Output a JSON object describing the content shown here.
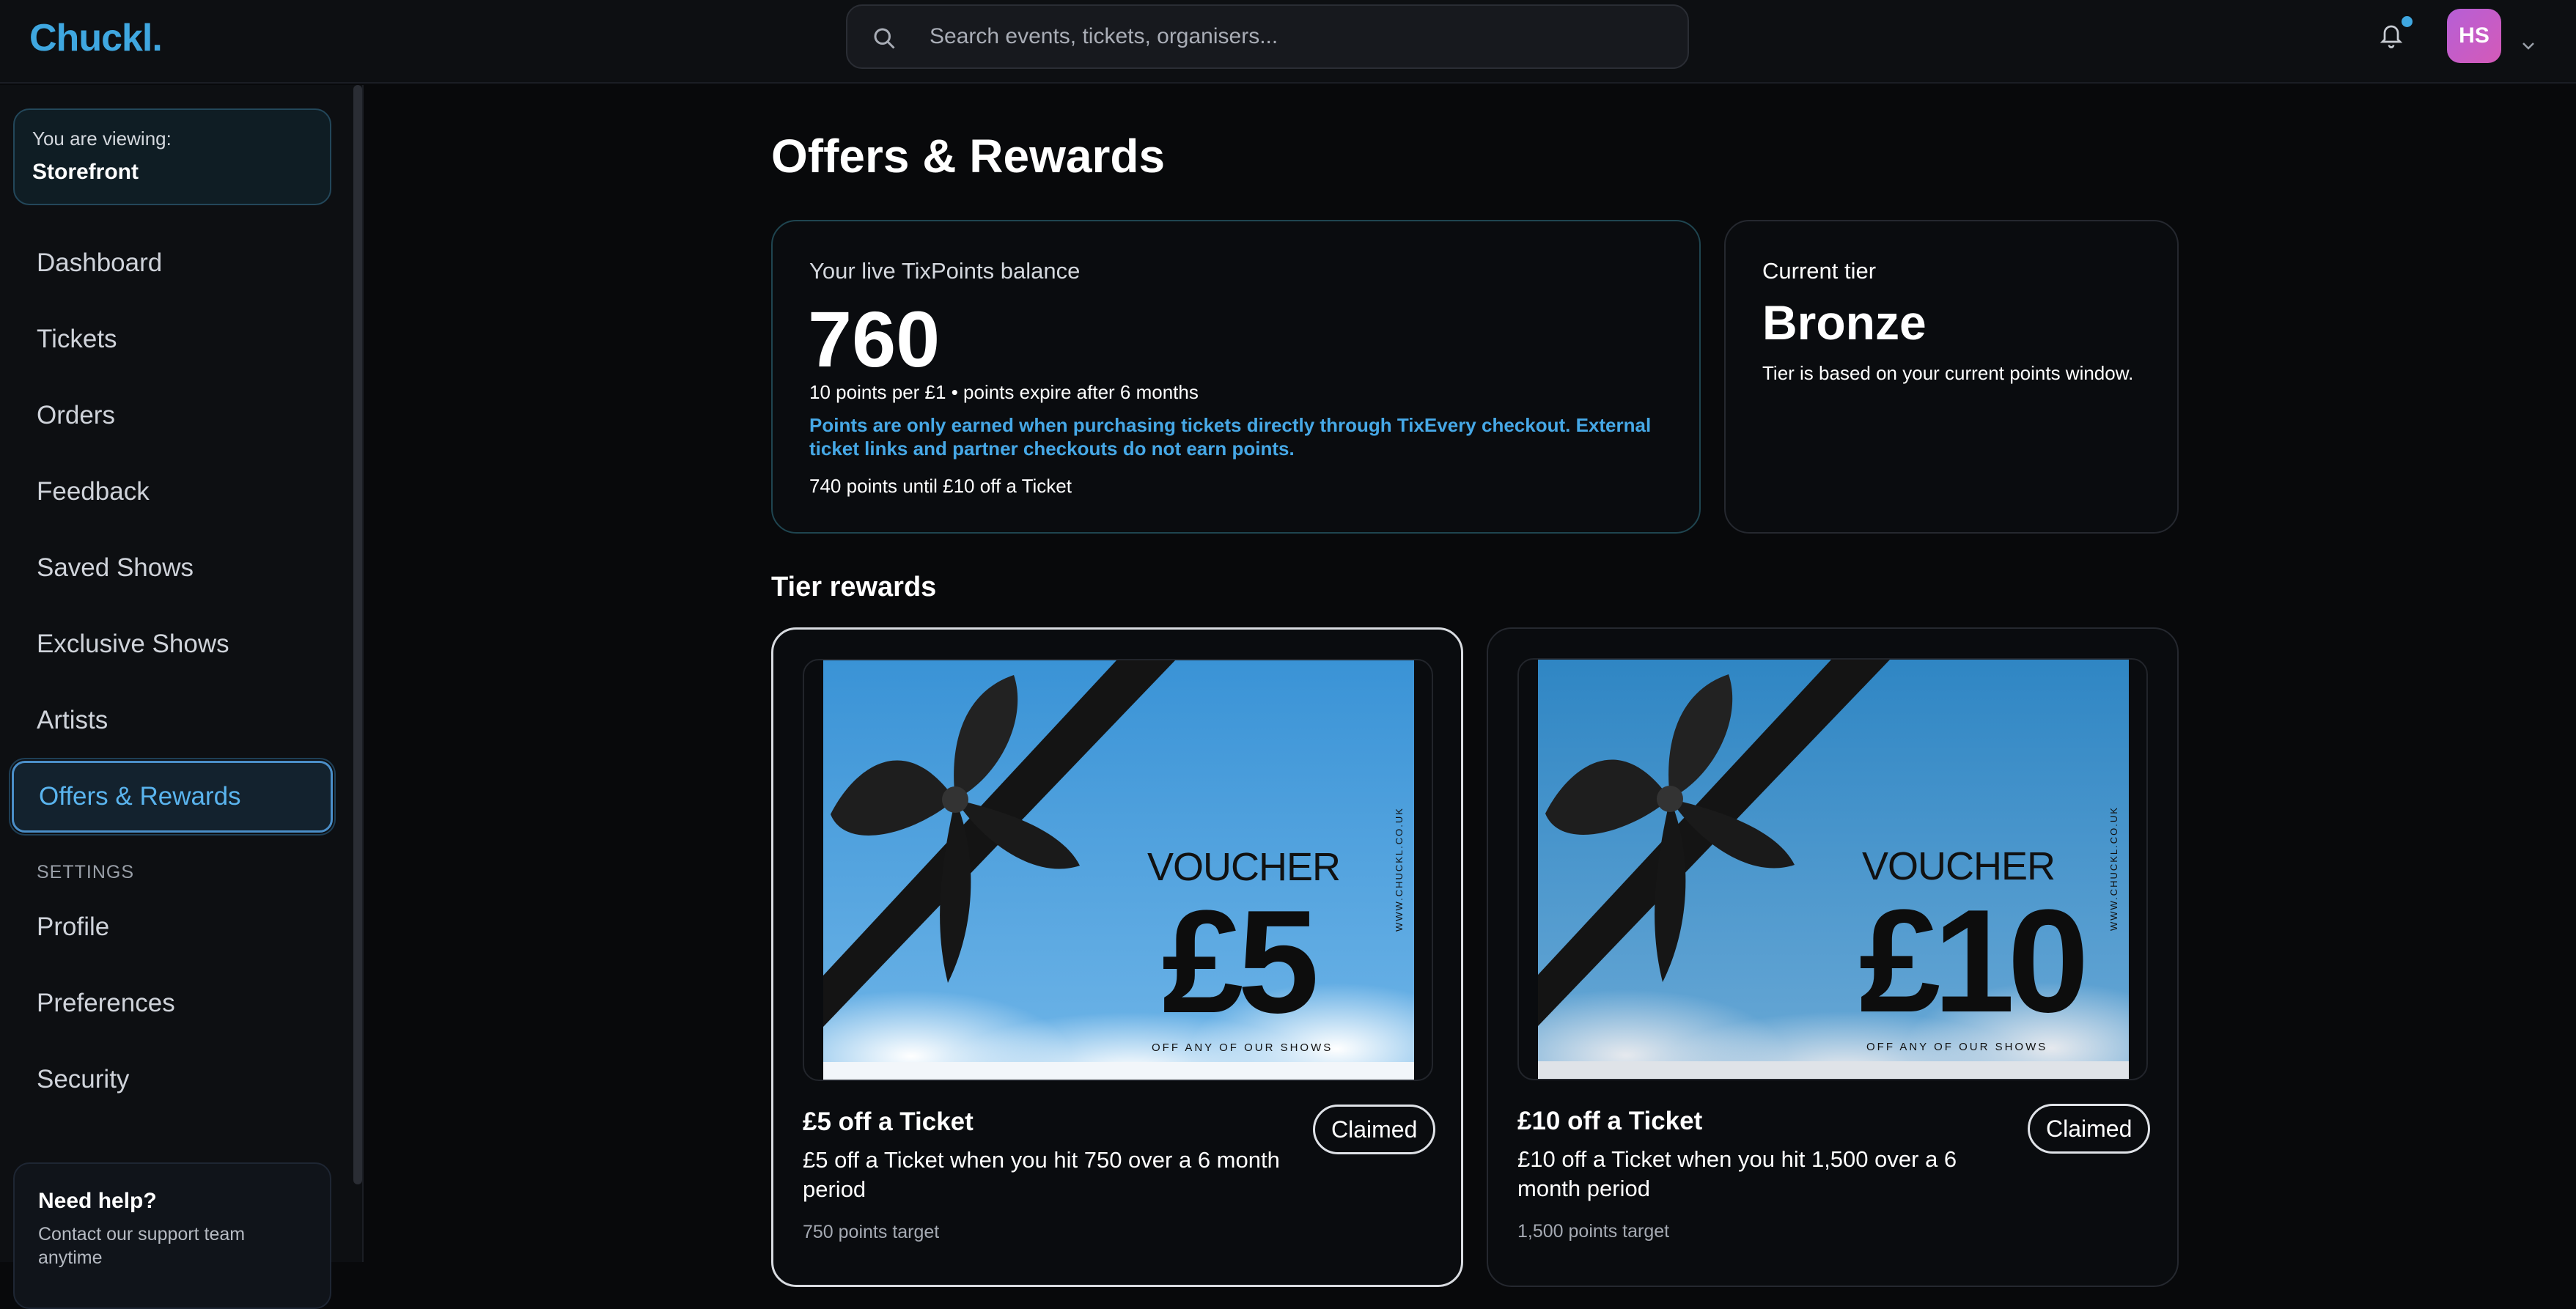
{
  "app": {
    "logo": "Chuckl."
  },
  "search": {
    "placeholder": "Search events, tickets, organisers..."
  },
  "user": {
    "initials": "HS",
    "has_notification": true
  },
  "sidebar": {
    "viewing_label": "You are viewing:",
    "viewing_value": "Storefront",
    "items": [
      {
        "label": "Dashboard"
      },
      {
        "label": "Tickets"
      },
      {
        "label": "Orders"
      },
      {
        "label": "Feedback"
      },
      {
        "label": "Saved Shows"
      },
      {
        "label": "Exclusive Shows"
      },
      {
        "label": "Artists"
      },
      {
        "label": "Offers & Rewards",
        "active": true
      }
    ],
    "settings_label": "SETTINGS",
    "settings_items": [
      {
        "label": "Profile"
      },
      {
        "label": "Preferences"
      },
      {
        "label": "Security"
      }
    ],
    "help": {
      "title": "Need help?",
      "subtitle": "Contact our support team anytime"
    }
  },
  "main": {
    "title": "Offers & Rewards",
    "balance": {
      "label": "Your live TixPoints balance",
      "points": "760",
      "rate": "10 points per £1 • points expire after 6 months",
      "note": "Points are only earned when purchasing tickets directly through TixEvery checkout. External ticket links and partner checkouts do not earn points.",
      "progress": "740 points until £10 off a Ticket"
    },
    "tier": {
      "label": "Current tier",
      "value": "Bronze",
      "description": "Tier is based on your current points window."
    },
    "rewards_title": "Tier rewards",
    "rewards": [
      {
        "name": "£5 off a Ticket",
        "description": "£5 off a Ticket when you hit 750 over a 6 month period",
        "target": "750 points target",
        "status": "Claimed",
        "voucher": {
          "heading": "VOUCHER",
          "amount": "£5",
          "footer": "OFF ANY OF OUR SHOWS",
          "site": "WWW.CHUCKL.CO.UK"
        }
      },
      {
        "name": "£10 off a Ticket",
        "description": "£10 off a Ticket when you hit 1,500 over a 6 month period",
        "target": "1,500 points target",
        "status": "Claimed",
        "voucher": {
          "heading": "VOUCHER",
          "amount": "£10",
          "footer": "OFF ANY OF OUR SHOWS",
          "site": "WWW.CHUCKL.CO.UK"
        }
      }
    ]
  },
  "colors": {
    "accent": "#3fa7e0",
    "background": "#08090b",
    "sky_top": "#3a93d6",
    "sky_bottom": "#6fb5e8"
  }
}
